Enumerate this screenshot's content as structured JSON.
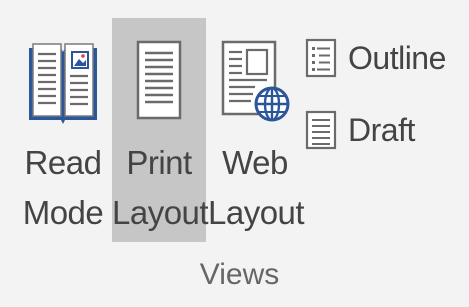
{
  "ribbon": {
    "group_label": "Views",
    "accent_color": "#2b579a",
    "selected_bg": "#c6c6c6",
    "buttons": [
      {
        "id": "read-mode",
        "line1": "Read",
        "line2": "Mode",
        "icon": "open-book-icon",
        "selected": false
      },
      {
        "id": "print-layout",
        "line1": "Print",
        "line2": "Layout",
        "icon": "page-icon",
        "selected": true
      },
      {
        "id": "web-layout",
        "line1": "Web",
        "line2": "Layout",
        "icon": "web-page-globe-icon",
        "selected": false
      }
    ],
    "small_buttons": [
      {
        "id": "outline",
        "label": "Outline",
        "icon": "outline-icon"
      },
      {
        "id": "draft",
        "label": "Draft",
        "icon": "draft-icon"
      }
    ]
  }
}
